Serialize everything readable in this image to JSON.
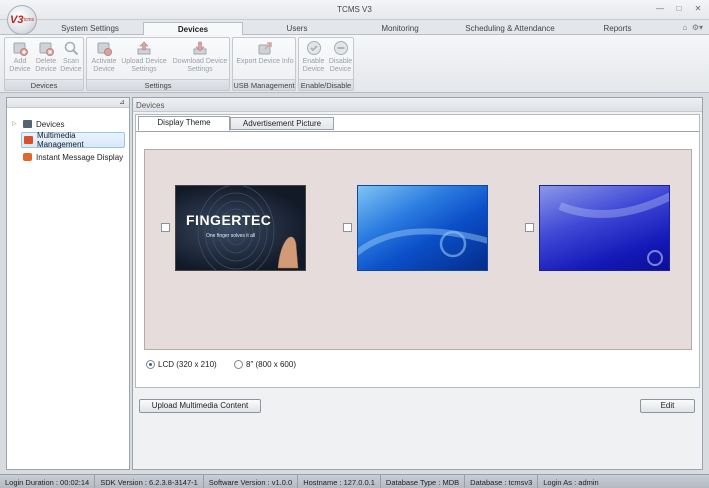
{
  "window": {
    "title": "TCMS V3"
  },
  "logo": {
    "text": "V3",
    "suffix": "tcms"
  },
  "tabs": [
    "System Settings",
    "Devices",
    "Users",
    "Monitoring",
    "Scheduling & Attendance",
    "Reports"
  ],
  "ribbon": {
    "groups": [
      {
        "title": "Devices",
        "buttons": [
          "Add Device",
          "Delete Device",
          "Scan Device"
        ]
      },
      {
        "title": "Settings",
        "buttons": [
          "Activate Device",
          "Upload Device Settings",
          "Download Device Settings"
        ]
      },
      {
        "title": "USB Management",
        "buttons": [
          "Export Device Info"
        ]
      },
      {
        "title": "Enable/Disable",
        "buttons": [
          "Enable Device",
          "Disable Device"
        ]
      }
    ]
  },
  "tree": {
    "items": [
      "Devices",
      "Multimedia Management",
      "Instant Message Display"
    ],
    "selected": "Multimedia Management"
  },
  "main": {
    "header": "Devices",
    "subtabs": [
      "Display Theme",
      "Advertisement Picture"
    ],
    "thumb1": {
      "brand": "FINGERTEC",
      "tagline": "One finger solves it all"
    },
    "resolutions": [
      {
        "label": "LCD (320 x 210)",
        "checked": true
      },
      {
        "label": "8\" (800 x 600)",
        "checked": false
      }
    ],
    "upload_label": "Upload Multimedia Content",
    "edit_label": "Edit"
  },
  "status": [
    "Login Duration : 00:02:14",
    "SDK Version : 6.2.3.8-3147-1",
    "Software Version : v1.0.0",
    "Hostname : 127.0.0.1",
    "Database Type : MDB",
    "Database : tcmsv3",
    "Login As : admin"
  ],
  "colors": {
    "accent": "#2e5fb3",
    "selection": "#d6e8fa",
    "theme_bg": "#e6dcdc"
  }
}
